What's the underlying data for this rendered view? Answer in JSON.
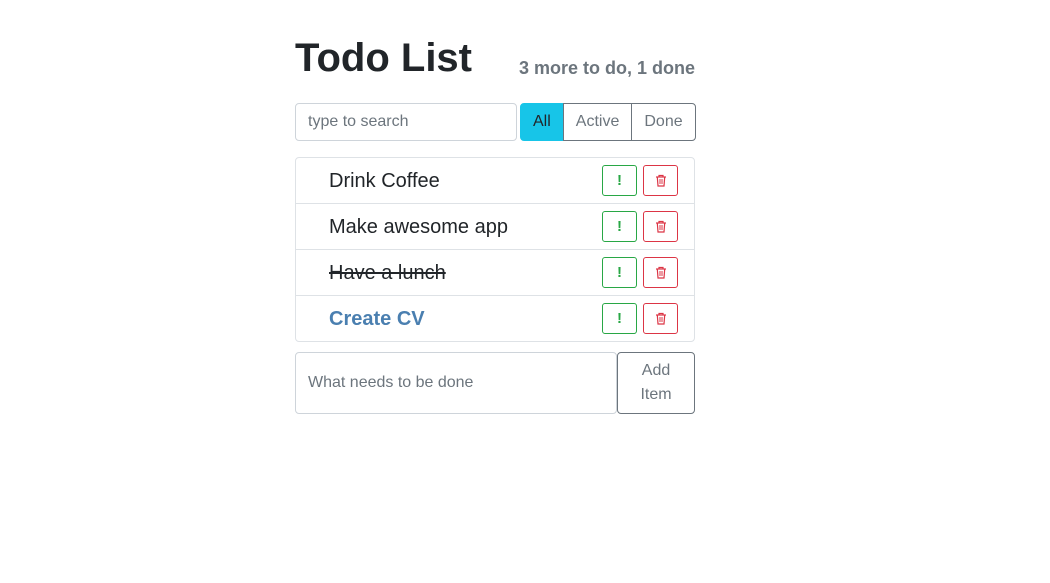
{
  "header": {
    "title": "Todo List",
    "counter": "3 more to do, 1 done"
  },
  "search": {
    "placeholder": "type to search",
    "value": ""
  },
  "filters": [
    {
      "label": "All",
      "active": true
    },
    {
      "label": "Active",
      "active": false
    },
    {
      "label": "Done",
      "active": false
    }
  ],
  "items": [
    {
      "label": "Drink Coffee",
      "done": false,
      "important": false
    },
    {
      "label": "Make awesome app",
      "done": false,
      "important": false
    },
    {
      "label": "Have a lunch",
      "done": true,
      "important": false
    },
    {
      "label": "Create CV",
      "done": false,
      "important": true
    }
  ],
  "item_actions": {
    "important_glyph": "!",
    "important_icon": "exclamation-icon",
    "delete_icon": "trash-icon"
  },
  "add_form": {
    "placeholder": "What needs to be done",
    "value": "",
    "button_label": "Add Item"
  },
  "colors": {
    "active_filter": "#17c5e8",
    "important_text": "#4a7fb0",
    "important_button": "#28a745",
    "delete_button": "#dc3545",
    "muted": "#6c757d"
  }
}
